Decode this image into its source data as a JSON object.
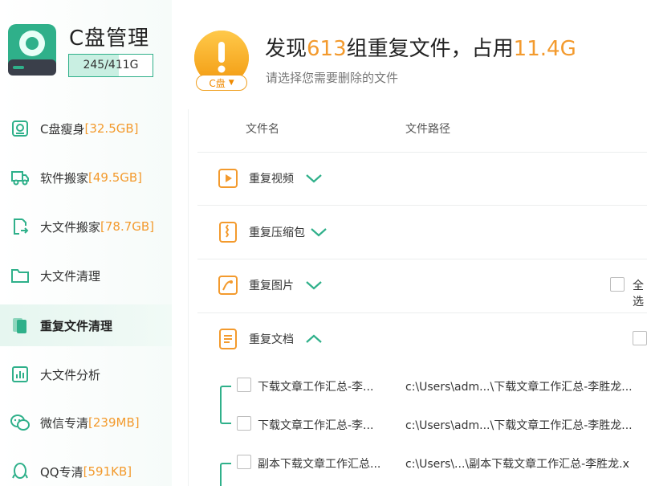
{
  "app": {
    "title": "C盘管理",
    "storage_text": "245/411G",
    "storage_used_fraction": 0.596
  },
  "colors": {
    "accent_green": "#2fb08a",
    "accent_orange": "#f39a2d"
  },
  "sidebar": {
    "items": [
      {
        "label": "C盘瘦身",
        "size": "[32.5GB]",
        "icon": "disk-slim-icon"
      },
      {
        "label": "软件搬家",
        "size": "[49.5GB]",
        "icon": "truck-icon"
      },
      {
        "label": "大文件搬家",
        "size": "[78.7GB]",
        "icon": "file-move-icon"
      },
      {
        "label": "大文件清理",
        "size": "",
        "icon": "folder-icon"
      },
      {
        "label": "重复文件清理",
        "size": "",
        "icon": "duplicate-files-icon",
        "active": true
      },
      {
        "label": "大文件分析",
        "size": "",
        "icon": "bar-chart-icon"
      },
      {
        "label": "微信专清",
        "size": "[239MB]",
        "icon": "wechat-icon"
      },
      {
        "label": "QQ专清",
        "size": "[591KB]",
        "icon": "qq-icon"
      }
    ]
  },
  "header": {
    "prefix": "发现",
    "group_count": "613",
    "middle": "组重复文件，占用",
    "total_size": "11.4G",
    "subtitle": "请选择您需要删除的文件",
    "drive_label": "C盘"
  },
  "table": {
    "col_name": "文件名",
    "col_path": "文件路径",
    "select_all": "全选",
    "groups": [
      {
        "label": "重复视频",
        "icon": "video-file-icon",
        "expanded": false
      },
      {
        "label": "重复压缩包",
        "icon": "zip-file-icon",
        "expanded": false
      },
      {
        "label": "重复图片",
        "icon": "image-file-icon",
        "expanded": false
      },
      {
        "label": "重复文档",
        "icon": "document-file-icon",
        "expanded": true
      }
    ],
    "files": [
      {
        "name": "下载文章工作汇总-李...",
        "path": "c:\\Users\\adm...\\下载文章工作汇总-李胜龙..."
      },
      {
        "name": "下载文章工作汇总-李...",
        "path": "c:\\Users\\adm...\\下载文章工作汇总-李胜龙..."
      },
      {
        "name": "副本下载文章工作汇总...",
        "path": "c:\\Users\\...\\副本下载文章工作汇总-李胜龙.x"
      }
    ]
  }
}
